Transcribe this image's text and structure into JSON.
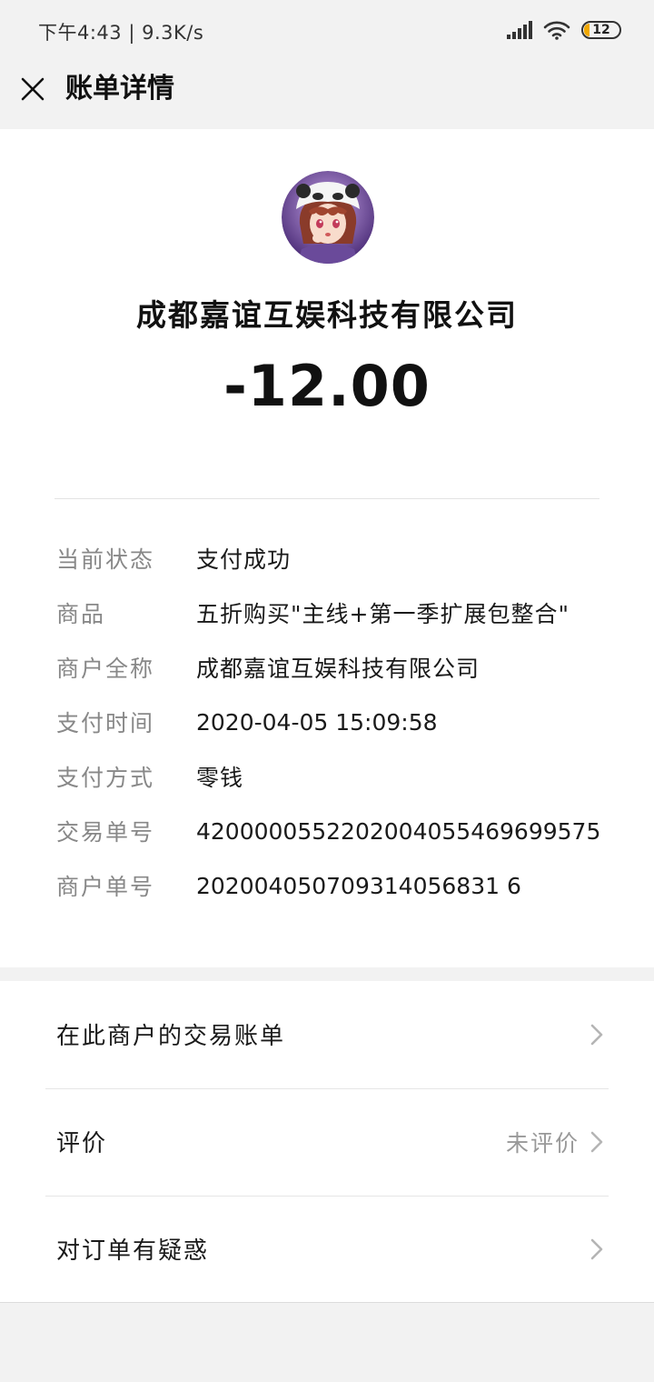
{
  "status_bar": {
    "time": "下午4:43 | 9.3K/s",
    "battery": "12",
    "battery_color": "#f0a800"
  },
  "header": {
    "title": "账单详情",
    "close_icon": "close-icon"
  },
  "bill": {
    "merchant_name": "成都嘉谊互娱科技有限公司",
    "amount": "-12.00",
    "details": [
      {
        "label": "当前状态",
        "value": "支付成功"
      },
      {
        "label": "商品",
        "value": "五折购买\"主线+第一季扩展包整合\""
      },
      {
        "label": "商户全称",
        "value": "成都嘉谊互娱科技有限公司"
      },
      {
        "label": "支付时间",
        "value": "2020-04-05 15:09:58"
      },
      {
        "label": "支付方式",
        "value": "零钱"
      },
      {
        "label": "交易单号",
        "value": "4200000552202004055469699575"
      },
      {
        "label": "商户单号",
        "value": "202004050709314056831 6"
      }
    ]
  },
  "menu": [
    {
      "label": "在此商户的交易账单",
      "status": ""
    },
    {
      "label": "评价",
      "status": "未评价"
    },
    {
      "label": "对订单有疑惑",
      "status": ""
    }
  ]
}
